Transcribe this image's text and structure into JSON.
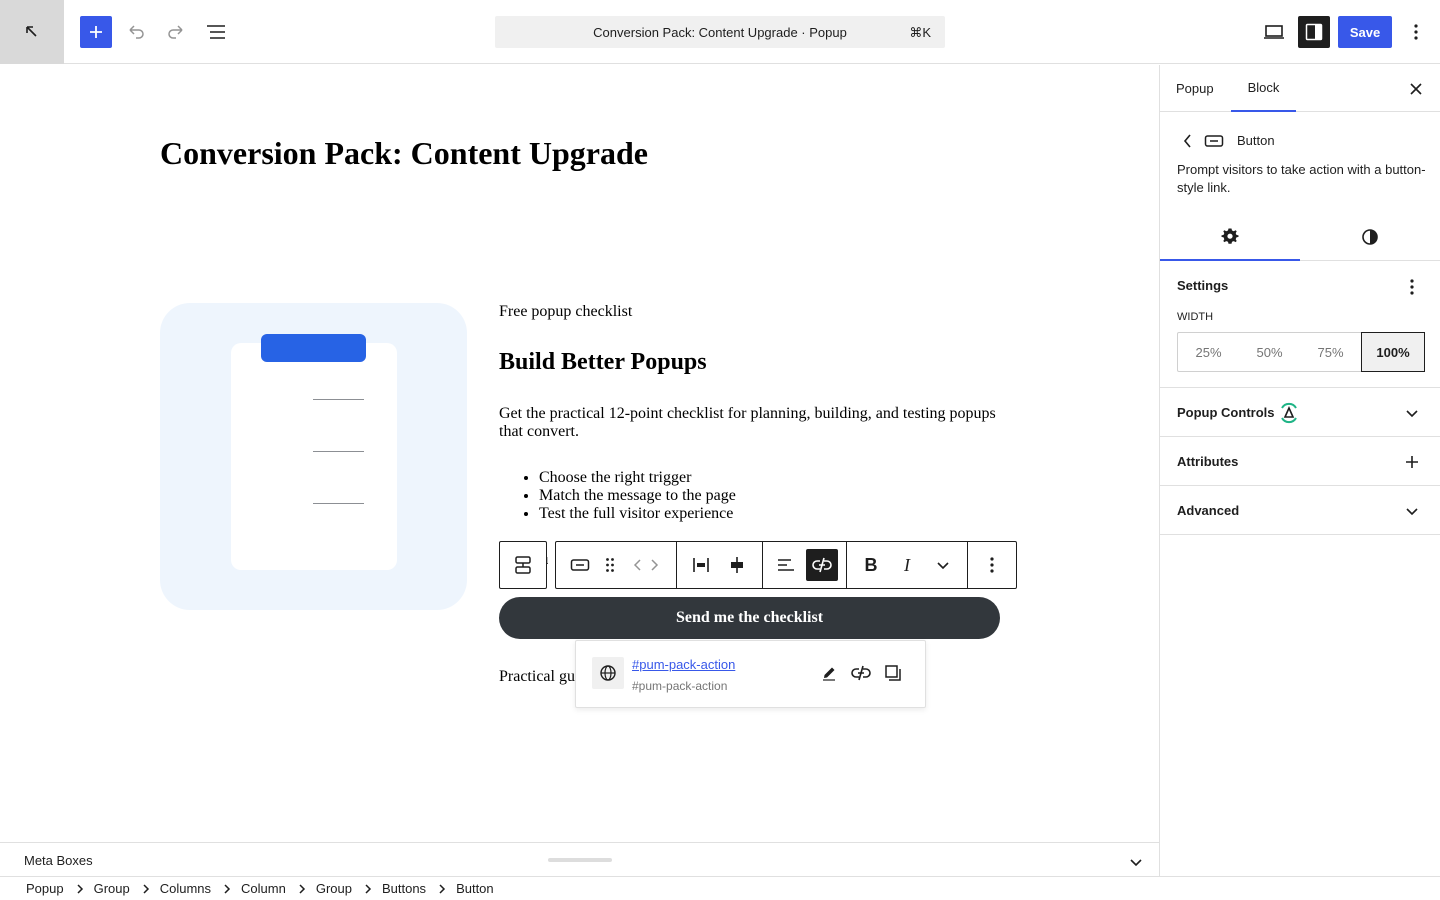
{
  "topbar": {
    "document_title": "Conversion Pack: Content Upgrade · Popup",
    "shortcut": "⌘K",
    "save_label": "Save"
  },
  "canvas": {
    "page_title": "Conversion Pack: Content Upgrade",
    "eyebrow": "Free popup checklist",
    "heading": "Build Better Popups",
    "body": "Get the practical 12-point checklist for planning, building, and testing popups that convert.",
    "bullets": [
      "Choose the right trigger",
      "Match the message to the page",
      "Test the full visitor experience"
    ],
    "partial_text": "u",
    "button_text": "Send me the checklist",
    "under_text": "Practical gu"
  },
  "toolbar": {
    "bold_label": "B",
    "italic_label": "I"
  },
  "link_popover": {
    "url": "#pum-pack-action",
    "url_sub": "#pum-pack-action"
  },
  "meta_boxes": {
    "label": "Meta Boxes"
  },
  "breadcrumb": [
    "Popup",
    "Group",
    "Columns",
    "Column",
    "Group",
    "Buttons",
    "Button"
  ],
  "sidebar": {
    "tabs": [
      "Popup",
      "Block"
    ],
    "active_tab": "Block",
    "block_title": "Button",
    "block_description": "Prompt visitors to take action with a button-style link.",
    "settings_title": "Settings",
    "width_label": "WIDTH",
    "width_options": [
      "25%",
      "50%",
      "75%",
      "100%"
    ],
    "width_selected": "100%",
    "panels": [
      "Popup Controls",
      "Attributes",
      "Advanced"
    ]
  },
  "colors": {
    "accent": "#3858e9",
    "button_bg": "#32373c",
    "image_bg": "#eef5fd",
    "clipboard_top": "#2763e5",
    "popup_controls_logo": "#1fb486"
  }
}
